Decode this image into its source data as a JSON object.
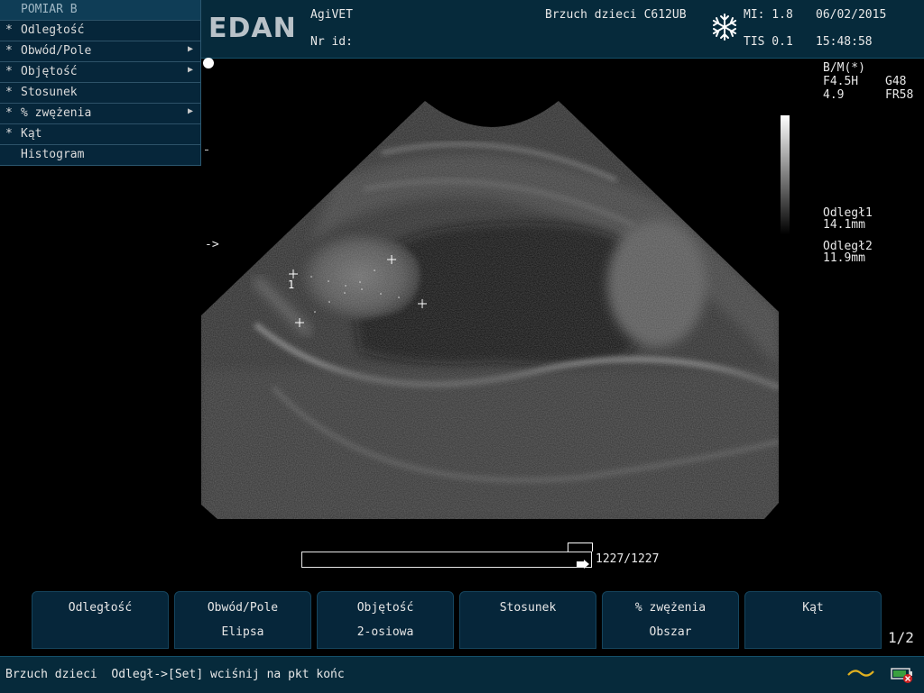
{
  "header": {
    "logo": "EDAN",
    "hospital": "AgiVET",
    "id_label": "Nr id:",
    "exam": "Brzuch dzieci C612UB",
    "mi": "MI: 1.8",
    "tis": "TIS 0.1",
    "date": "06/02/2015",
    "time": "15:48:58"
  },
  "menu": {
    "title": "POMIAR B",
    "items": [
      {
        "label": "Odległość",
        "submenu": false
      },
      {
        "label": "Obwód/Pole",
        "submenu": true
      },
      {
        "label": "Objętość",
        "submenu": true
      },
      {
        "label": "Stosunek",
        "submenu": false
      },
      {
        "label": "% zwężenia",
        "submenu": true
      },
      {
        "label": "Kąt",
        "submenu": false
      },
      {
        "label": "Histogram",
        "submenu": false
      }
    ],
    "star": "*",
    "arrow": "▶"
  },
  "image_params": {
    "mode": "B/M(*)",
    "freq": "F4.5H",
    "gain": "G48",
    "depth": "4.9",
    "frame_rate": "FR58"
  },
  "measurements": [
    {
      "label": "Odległ1",
      "value": "14.1mm"
    },
    {
      "label": "Odległ2",
      "value": "11.9mm"
    }
  ],
  "scan": {
    "caliper_label": "1",
    "focus_marker": "->"
  },
  "cine": {
    "counter": "1227/1227",
    "progress": 1.0
  },
  "softkeys": [
    {
      "line1": "Odległość",
      "line2": ""
    },
    {
      "line1": "Obwód/Pole",
      "line2": "Elipsa"
    },
    {
      "line1": "Objętość",
      "line2": "2-osiowa"
    },
    {
      "line1": "Stosunek",
      "line2": ""
    },
    {
      "line1": "% zwężenia",
      "line2": "Obszar"
    },
    {
      "line1": "Kąt",
      "line2": ""
    }
  ],
  "page_indicator": "1/2",
  "status": {
    "text": "Brzuch dzieci  Odległ->[Set] wciśnij na pkt końc"
  },
  "colors": {
    "panel": "#062a3b",
    "border": "#14506a",
    "text": "#e8e8e8"
  },
  "icons": [
    "freeze-snowflake-icon",
    "wave-icon",
    "battery-icon"
  ]
}
